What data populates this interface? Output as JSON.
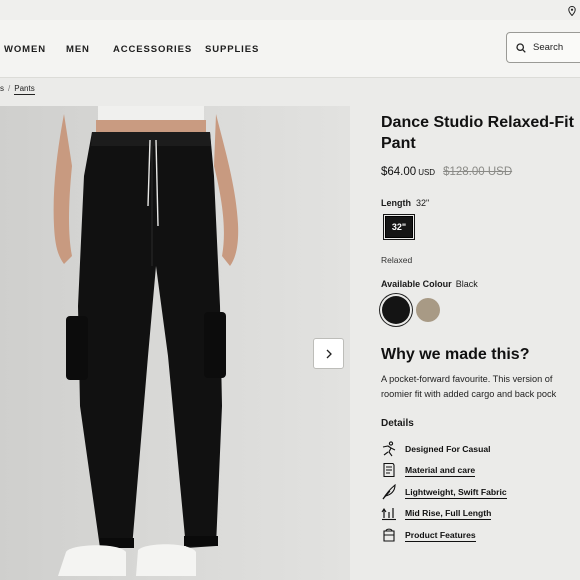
{
  "topbar": {
    "location_icon": "location-pin-icon"
  },
  "nav": {
    "items": [
      "WOMEN",
      "MEN",
      "ACCESSORIES",
      "SUPPLIES"
    ],
    "search_label": "Search",
    "search_icon": "search-icon"
  },
  "breadcrumb": {
    "parent": "s",
    "separator": "/",
    "current": "Pants"
  },
  "product": {
    "title_line1": "Dance Studio Relaxed-Fit",
    "title_line2": "Pant",
    "price": "$64.00",
    "price_currency": "USD",
    "original_price": "$128.00 USD",
    "length_label": "Length",
    "length_selected": "32\"",
    "length_option": "32\"",
    "fit": "Relaxed",
    "colour_label": "Available Colour",
    "colour_selected": "Black",
    "swatches": [
      {
        "name": "Black",
        "color": "#141414"
      },
      {
        "name": "Taupe",
        "color": "#a89a85"
      }
    ],
    "carousel_next_icon": "chevron-right-icon"
  },
  "why": {
    "heading": "Why we made this?",
    "line1": "A pocket-forward favourite. This version of",
    "line2": "roomier fit with added cargo and back pock"
  },
  "details": {
    "heading": "Details",
    "items": [
      {
        "label": "Designed For Casual",
        "icon": "person-activity-icon",
        "linked": false
      },
      {
        "label": "Material and care",
        "icon": "care-label-icon",
        "linked": true
      },
      {
        "label": "Lightweight, Swift Fabric",
        "icon": "feather-icon",
        "linked": true
      },
      {
        "label": "Mid Rise, Full Length",
        "icon": "rise-arrow-icon",
        "linked": true
      },
      {
        "label": "Product Features",
        "icon": "product-box-icon",
        "linked": true
      }
    ]
  }
}
